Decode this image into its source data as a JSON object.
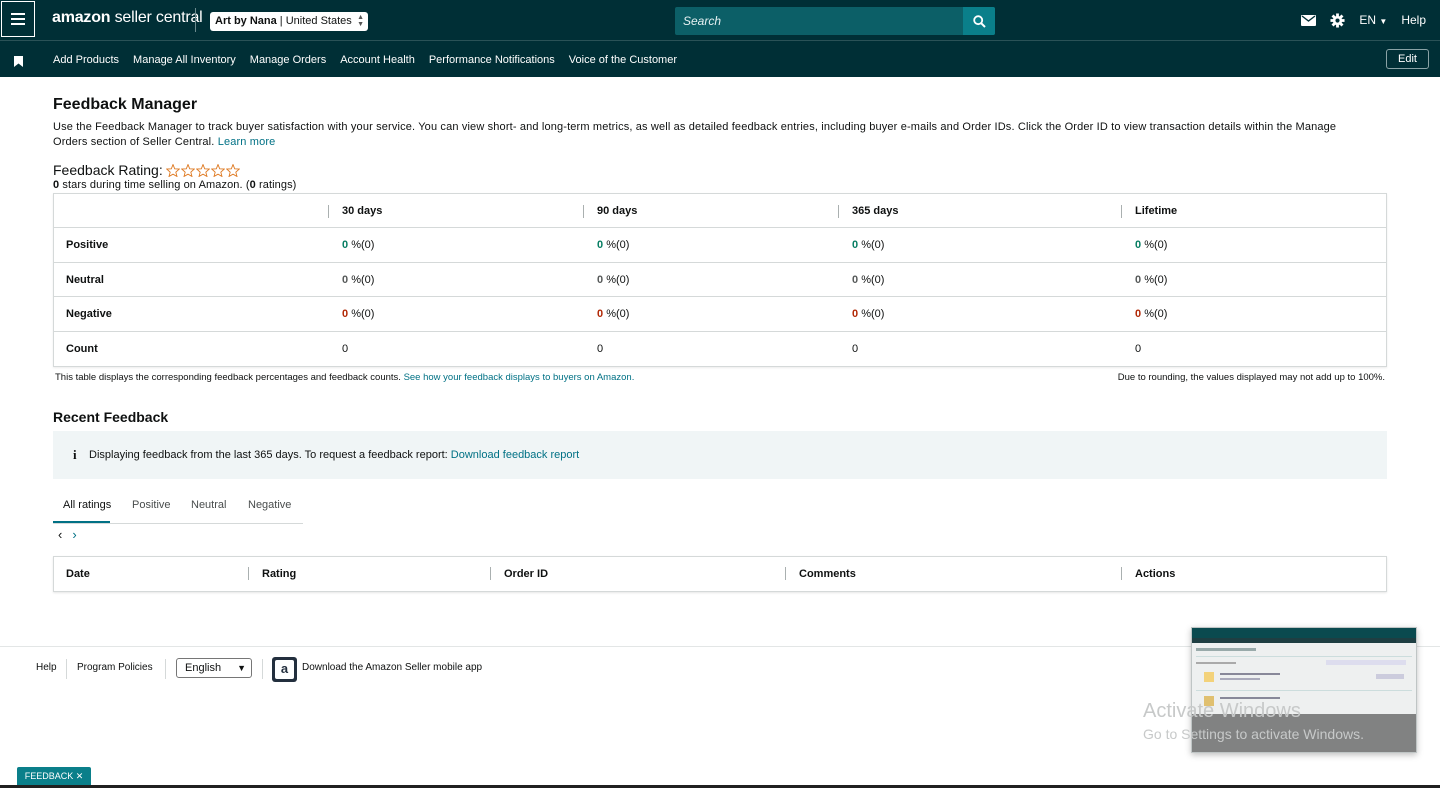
{
  "topbar": {
    "logo_main": "amazon",
    "logo_sub": " seller central",
    "store_name": "Art by Nana",
    "store_region": " | United States",
    "search_placeholder": "Search",
    "lang": "EN",
    "help": "Help"
  },
  "navbar": {
    "links": [
      "Add Products",
      "Manage All Inventory",
      "Manage Orders",
      "Account Health",
      "Performance Notifications",
      "Voice of the Customer"
    ],
    "edit": "Edit"
  },
  "page": {
    "title": "Feedback Manager",
    "description": "Use the Feedback Manager to track buyer satisfaction with your service. You can view short- and long-term metrics, as well as detailed feedback entries, including buyer e-mails and Order IDs. Click the Order ID to view transaction details within the Manage Orders section of Seller Central.",
    "learn_more": "Learn more",
    "rating_label": "Feedback Rating:",
    "rating_stars": 0,
    "rating_sub_stars": "0",
    "rating_sub_text_1": " stars during time selling on Amazon. (",
    "rating_sub_count": "0",
    "rating_sub_text_2": " ratings)"
  },
  "metrics": {
    "columns": [
      "30 days",
      "90 days",
      "365 days",
      "Lifetime"
    ],
    "rows": [
      {
        "label": "Positive",
        "values": [
          "0",
          "0",
          "0",
          "0"
        ],
        "suffix": "%(0)"
      },
      {
        "label": "Neutral",
        "values": [
          "0",
          "0",
          "0",
          "0"
        ],
        "suffix": "%(0)"
      },
      {
        "label": "Negative",
        "values": [
          "0",
          "0",
          "0",
          "0"
        ],
        "suffix": "%(0)"
      },
      {
        "label": "Count",
        "values": [
          "0",
          "0",
          "0",
          "0"
        ],
        "suffix": ""
      }
    ],
    "note_left": "This table displays the corresponding feedback percentages and feedback counts.",
    "note_left_link": "See how your feedback displays to buyers on Amazon.",
    "note_right": "Due to rounding, the values displayed may not add up to 100%."
  },
  "recent": {
    "title": "Recent Feedback",
    "info_text": "Displaying feedback from the last 365 days. To request a feedback report:",
    "info_link": "Download feedback report",
    "tabs": [
      "All ratings",
      "Positive",
      "Neutral",
      "Negative"
    ],
    "pager_prev": "‹",
    "pager_next": "›",
    "table_headers": [
      "Date",
      "Rating",
      "Order ID",
      "Comments",
      "Actions"
    ]
  },
  "footer": {
    "help": "Help",
    "policies": "Program Policies",
    "language": "English",
    "app_text": "Download the Amazon Seller mobile app"
  },
  "overlay": {
    "watermark_title": "Activate Windows",
    "watermark_sub": "Go to Settings to activate Windows.",
    "feedback_tab": "FEEDBACK ✕"
  },
  "colors": {
    "header_bg": "#002f36",
    "link": "#007185",
    "positive": "#067d62",
    "negative": "#b12704"
  }
}
